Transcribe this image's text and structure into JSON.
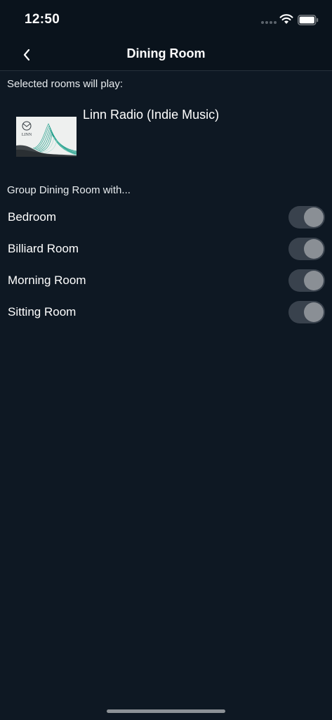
{
  "status_bar": {
    "time": "12:50",
    "signal_icon": "cellular-dots-icon",
    "wifi_icon": "wifi-icon",
    "battery_icon": "battery-icon"
  },
  "nav": {
    "back_icon": "chevron-left-icon",
    "title": "Dining Room"
  },
  "selected": {
    "label": "Selected rooms will play:",
    "station": "Linn Radio (Indie Music)",
    "artwork_logo_text": "LINN"
  },
  "group": {
    "label": "Group Dining Room with...",
    "rooms": [
      {
        "name": "Bedroom",
        "enabled": false
      },
      {
        "name": "Billiard Room",
        "enabled": false
      },
      {
        "name": "Morning Room",
        "enabled": false
      },
      {
        "name": "Sitting Room",
        "enabled": false
      }
    ]
  },
  "colors": {
    "background": "#0e1823",
    "toggle_track": "#39424d",
    "toggle_knob": "#8a8f95",
    "artwork_accent": "#1f9e8a"
  }
}
